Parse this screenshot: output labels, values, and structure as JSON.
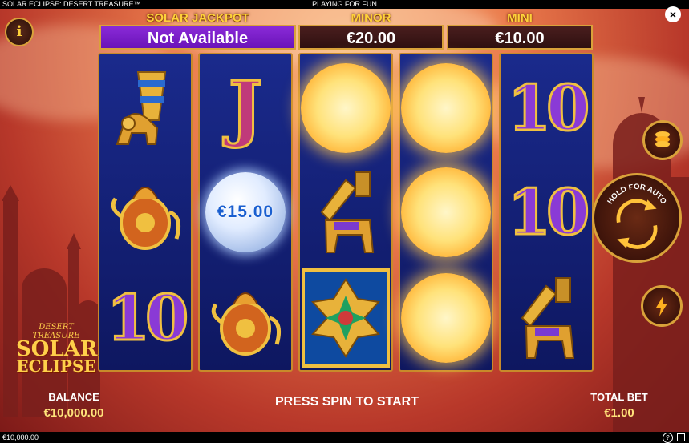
{
  "game": {
    "title": "SOLAR ECLIPSE: DESERT TREASURE™",
    "mode": "PLAYING FOR FUN",
    "footer_balance": "€10,000.00",
    "help_icon": "?"
  },
  "jackpots": [
    {
      "label": "SOLAR JACKPOT",
      "value": "Not Available"
    },
    {
      "label": "MINOR",
      "value": "€20.00"
    },
    {
      "label": "MINI",
      "value": "€10.00"
    }
  ],
  "reels": [
    [
      "winged-lion-rhyton",
      "golden-teapot",
      "ten"
    ],
    [
      "j",
      "moon-coin",
      "golden-teapot"
    ],
    [
      "sun",
      "lamassu",
      "ornament-wild"
    ],
    [
      "sun",
      "sun",
      "sun"
    ],
    [
      "ten",
      "ten",
      "lamassu"
    ]
  ],
  "symbols": {
    "ten": "10",
    "j": "J",
    "moon_value": "€15.00"
  },
  "logo": {
    "line1": "DESERT TREASURE",
    "line2": "SOLAR",
    "line3": "ECLIPSE"
  },
  "hud": {
    "balance_label": "BALANCE",
    "balance_value": "€10,000.00",
    "message": "PRESS SPIN TO START",
    "total_bet_label": "TOTAL BET",
    "total_bet_value": "€1.00",
    "hold_for_auto": "HOLD FOR AUTO"
  },
  "buttons": {
    "info": "i",
    "close": "×"
  }
}
